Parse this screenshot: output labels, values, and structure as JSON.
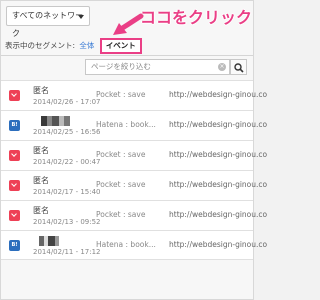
{
  "network_select": {
    "label": "すべてのネットワーク"
  },
  "annotation": {
    "text": "ココをクリック",
    "color": "#ea3f86"
  },
  "segment": {
    "label": "表示中のセグメント:",
    "all_link": "全体",
    "selected": "イベント"
  },
  "search": {
    "placeholder": "ページを絞り込む"
  },
  "rows": [
    {
      "service": "pocket",
      "user": "匿名",
      "date": "2014/02/26 - 17:07",
      "desc": "Pocket : save",
      "url": "http://webdesign-ginou.co"
    },
    {
      "service": "hatena",
      "icon_text": "B!",
      "user": "",
      "date": "2014/02/25 - 16:56",
      "desc": "Hatena : book...",
      "url": "http://webdesign-ginou.co"
    },
    {
      "service": "pocket",
      "user": "匿名",
      "date": "2014/02/22 - 00:47",
      "desc": "Pocket : save",
      "url": "http://webdesign-ginou.co"
    },
    {
      "service": "pocket",
      "user": "匿名",
      "date": "2014/02/17 - 15:40",
      "desc": "Pocket : save",
      "url": "http://webdesign-ginou.co"
    },
    {
      "service": "pocket",
      "user": "匿名",
      "date": "2014/02/13 - 09:52",
      "desc": "Pocket : save",
      "url": "http://webdesign-ginou.co"
    },
    {
      "service": "hatena",
      "icon_text": "B!",
      "user": "",
      "date": "2014/02/11 - 17:12",
      "desc": "Hatena : book...",
      "url": "http://webdesign-ginou.co"
    }
  ]
}
